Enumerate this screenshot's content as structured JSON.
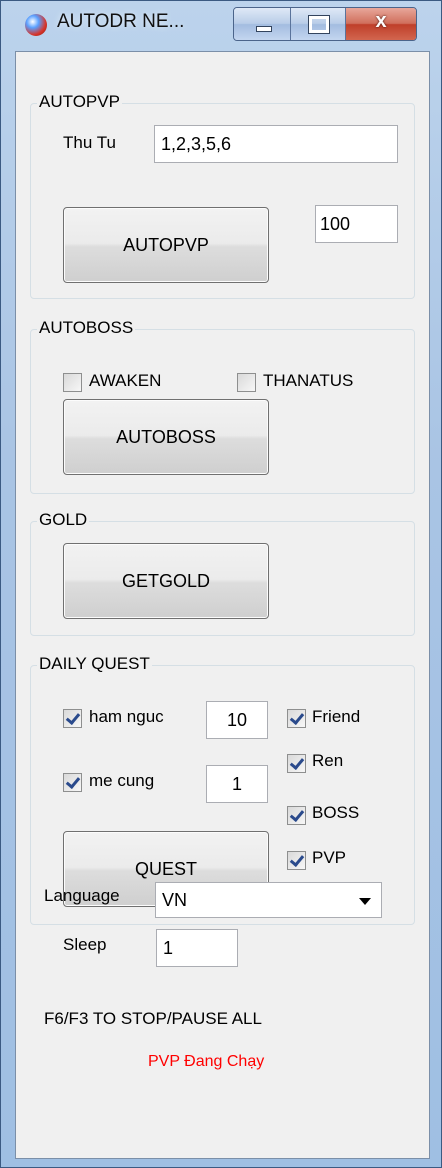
{
  "window": {
    "title": "AUTODR NE...",
    "close_glyph": "x",
    "icon": "app-orb-icon"
  },
  "autopvp": {
    "group_label": "AUTOPVP",
    "thutu_label": "Thu Tu",
    "thutu_value": "1,2,3,5,6",
    "count_value": "100",
    "button_label": "AUTOPVP"
  },
  "autoboss": {
    "group_label": "AUTOBOSS",
    "awaken_label": "AWAKEN",
    "awaken_checked": false,
    "thanatus_label": "THANATUS",
    "thanatus_checked": false,
    "button_label": "AUTOBOSS"
  },
  "gold": {
    "group_label": "GOLD",
    "button_label": "GETGOLD"
  },
  "daily_quest": {
    "group_label": "DAILY QUEST",
    "ham_nguc_label": "ham nguc",
    "ham_nguc_value": "10",
    "me_cung_label": "me cung",
    "me_cung_value": "1",
    "friend_label": "Friend",
    "ren_label": "Ren",
    "boss_label": "BOSS",
    "pvp_label": "PVP",
    "button_label": "QUEST"
  },
  "settings": {
    "language_label": "Language",
    "language_value": "VN",
    "sleep_label": "Sleep",
    "sleep_value": "1"
  },
  "hint_text": "F6/F3 TO STOP/PAUSE ALL",
  "status_text": "PVP Đang Chạy",
  "colors": {
    "status": "#ff0000",
    "frame": "#a9c4e4",
    "client_bg": "#f0f0f0"
  }
}
